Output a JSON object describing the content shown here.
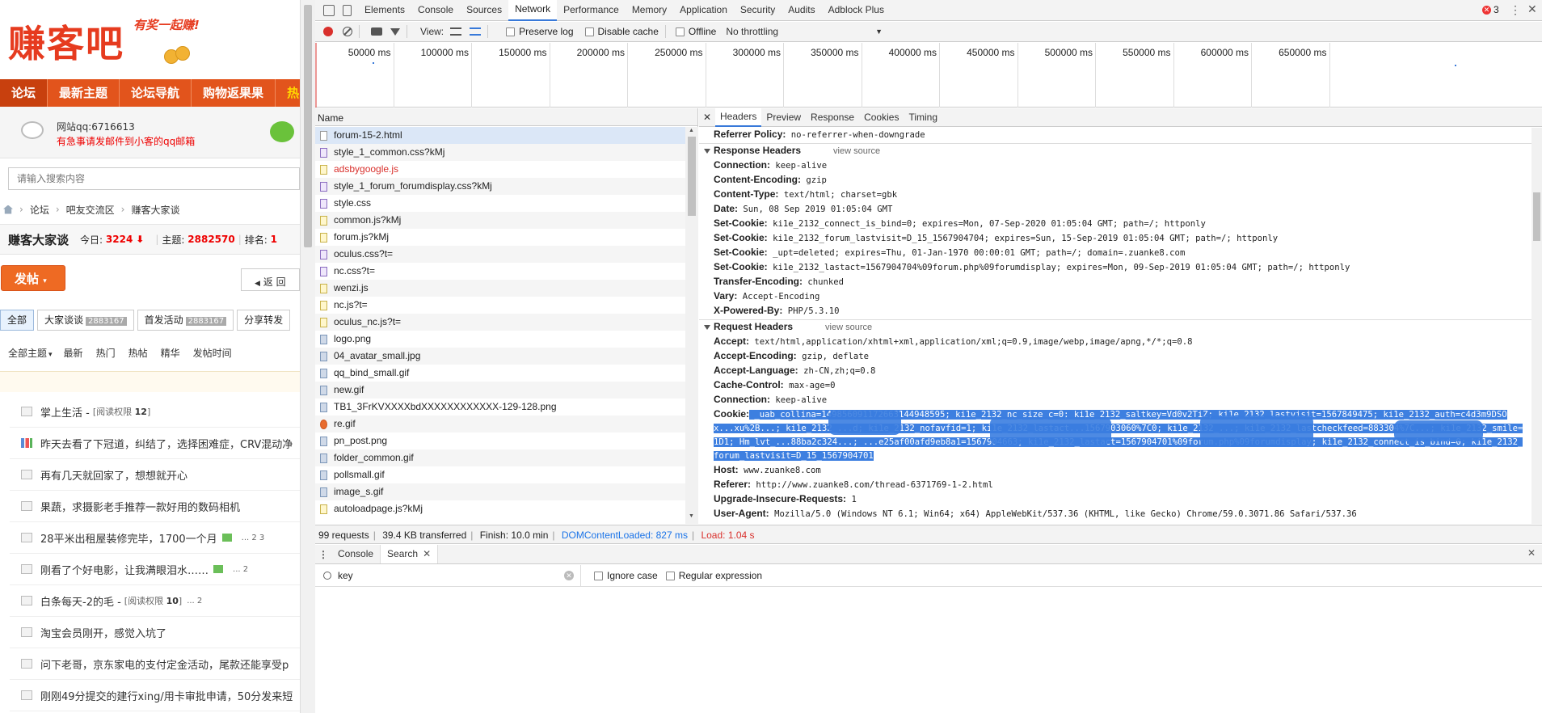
{
  "site": {
    "logo_text": "赚客吧",
    "slogan": "有奖一起赚!",
    "nav": [
      "论坛",
      "最新主题",
      "论坛导航",
      "购物返果果",
      "热"
    ],
    "notice_line1": "网站qq:6716613",
    "notice_line2": "有急事请发邮件到小客的qq邮箱",
    "search_placeholder": "请输入搜索内容",
    "breadcrumb": [
      "论坛",
      "吧友交流区",
      "赚客大家谈"
    ],
    "forum": {
      "name": "赚客大家谈",
      "today_label": "今日:",
      "today": "3224",
      "topics_label": "主题:",
      "topics": "2882570",
      "rank_label": "排名:",
      "rank": "1"
    },
    "post_button": "发帖",
    "back_button": "返 回",
    "tabs": [
      {
        "label": "全部",
        "count": ""
      },
      {
        "label": "大家谈谈",
        "count": "2883167"
      },
      {
        "label": "首发活动",
        "count": "2883167"
      },
      {
        "label": "分享转发",
        "count": ""
      }
    ],
    "sort": [
      "全部主题",
      "最新",
      "热门",
      "热帖",
      "精华",
      "发帖时间"
    ],
    "threads": [
      {
        "title": "掌上生活 - ",
        "meta": "[阅读权限 ",
        "level": "12",
        "close": "]",
        "pages": ""
      },
      {
        "title": "昨天去看了下冠道，纠结了，选择困难症，CRV混动净",
        "meta": "",
        "level": "",
        "close": "",
        "pages": ""
      },
      {
        "title": "再有几天就回家了，想想就开心",
        "meta": "",
        "level": "",
        "close": "",
        "pages": ""
      },
      {
        "title": "果蔬，求摄影老手推荐一款好用的数码相机",
        "meta": "",
        "level": "",
        "close": "",
        "pages": ""
      },
      {
        "title": "28平米出租屋装修完毕，1700一个月",
        "meta": "",
        "level": "",
        "close": "",
        "pages": "... 2  3"
      },
      {
        "title": "刚看了个好电影，让我满眼泪水……",
        "meta": "",
        "level": "",
        "close": "",
        "pages": "... 2"
      },
      {
        "title": "白条每天-2的毛 - ",
        "meta": "[阅读权限 ",
        "level": "10",
        "close": "]",
        "pages": "... 2"
      },
      {
        "title": "淘宝会员刚开，感觉入坑了",
        "meta": "",
        "level": "",
        "close": "",
        "pages": ""
      },
      {
        "title": "问下老哥，京东家电的支付定金活动，尾款还能享受p",
        "meta": "",
        "level": "",
        "close": "",
        "pages": ""
      },
      {
        "title": "刚刚49分提交的建行xing/用卡审批申请，50分发来短",
        "meta": "",
        "level": "",
        "close": "",
        "pages": ""
      }
    ]
  },
  "devtools": {
    "tabs": [
      "Elements",
      "Console",
      "Sources",
      "Network",
      "Performance",
      "Memory",
      "Application",
      "Security",
      "Audits",
      "Adblock Plus"
    ],
    "active_tab": "Network",
    "error_count": "3",
    "toolbar": {
      "view_label": "View:",
      "preserve_log": "Preserve log",
      "disable_cache": "Disable cache",
      "offline": "Offline",
      "throttling": "No throttling"
    },
    "timeline_ticks": [
      "50000 ms",
      "100000 ms",
      "150000 ms",
      "200000 ms",
      "250000 ms",
      "300000 ms",
      "350000 ms",
      "400000 ms",
      "450000 ms",
      "500000 ms",
      "550000 ms",
      "600000 ms",
      "650000 ms"
    ],
    "list_header": "Name",
    "requests": [
      {
        "name": "forum-15-2.html",
        "type": "doc",
        "error": false
      },
      {
        "name": "style_1_common.css?kMj",
        "type": "css",
        "error": false
      },
      {
        "name": "adsbygoogle.js",
        "type": "js",
        "error": true
      },
      {
        "name": "style_1_forum_forumdisplay.css?kMj",
        "type": "css",
        "error": false
      },
      {
        "name": "style.css",
        "type": "css",
        "error": false
      },
      {
        "name": "common.js?kMj",
        "type": "js",
        "error": false
      },
      {
        "name": "forum.js?kMj",
        "type": "js",
        "error": false
      },
      {
        "name": "oculus.css?t=",
        "type": "css",
        "error": false
      },
      {
        "name": "nc.css?t=",
        "type": "css",
        "error": false
      },
      {
        "name": "wenzi.js",
        "type": "js",
        "error": false
      },
      {
        "name": "nc.js?t=",
        "type": "js",
        "error": false
      },
      {
        "name": "oculus_nc.js?t=",
        "type": "js",
        "error": false
      },
      {
        "name": "logo.png",
        "type": "img",
        "error": false
      },
      {
        "name": "04_avatar_small.jpg",
        "type": "img",
        "error": false
      },
      {
        "name": "qq_bind_small.gif",
        "type": "img",
        "error": false
      },
      {
        "name": "new.gif",
        "type": "img",
        "error": false
      },
      {
        "name": "TB1_3FrKVXXXXbdXXXXXXXXXXXX-129-128.png",
        "type": "img",
        "error": false
      },
      {
        "name": "re.gif",
        "type": "red",
        "error": false
      },
      {
        "name": "pn_post.png",
        "type": "img",
        "error": false
      },
      {
        "name": "folder_common.gif",
        "type": "img",
        "error": false
      },
      {
        "name": "pollsmall.gif",
        "type": "img",
        "error": false
      },
      {
        "name": "image_s.gif",
        "type": "img",
        "error": false
      },
      {
        "name": "autoloadpage.js?kMj",
        "type": "js",
        "error": false
      }
    ],
    "status": {
      "requests": "99 requests",
      "transferred": "39.4 KB transferred",
      "finish": "Finish: 10.0 min",
      "dcl": "DOMContentLoaded: 827 ms",
      "load": "Load: 1.04 s"
    },
    "detail_tabs": [
      "Headers",
      "Preview",
      "Response",
      "Cookies",
      "Timing"
    ],
    "referrer_policy": {
      "k": "Referrer Policy:",
      "v": "no-referrer-when-downgrade"
    },
    "response_headers_title": "Response Headers",
    "request_headers_title": "Request Headers",
    "view_source": "view source",
    "response_headers": [
      {
        "k": "Connection:",
        "v": "keep-alive"
      },
      {
        "k": "Content-Encoding:",
        "v": "gzip"
      },
      {
        "k": "Content-Type:",
        "v": "text/html; charset=gbk"
      },
      {
        "k": "Date:",
        "v": "Sun, 08 Sep 2019 01:05:04 GMT"
      },
      {
        "k": "Set-Cookie:",
        "v": "ki1e_2132_connect_is_bind=0; expires=Mon, 07-Sep-2020 01:05:04 GMT; path=/; httponly"
      },
      {
        "k": "Set-Cookie:",
        "v": "ki1e_2132_forum_lastvisit=D_15_1567904704; expires=Sun, 15-Sep-2019 01:05:04 GMT; path=/; httponly"
      },
      {
        "k": "Set-Cookie:",
        "v": "_upt=deleted; expires=Thu, 01-Jan-1970 00:00:01 GMT; path=/; domain=.zuanke8.com"
      },
      {
        "k": "Set-Cookie:",
        "v": "ki1e_2132_lastact=1567904704%09forum.php%09forumdisplay; expires=Mon, 09-Sep-2019 01:05:04 GMT; path=/; httponly"
      },
      {
        "k": "Transfer-Encoding:",
        "v": "chunked"
      },
      {
        "k": "Vary:",
        "v": "Accept-Encoding"
      },
      {
        "k": "X-Powered-By:",
        "v": "PHP/5.3.10"
      }
    ],
    "request_headers": [
      {
        "k": "Accept:",
        "v": "text/html,application/xhtml+xml,application/xml;q=0.9,image/webp,image/apng,*/*;q=0.8"
      },
      {
        "k": "Accept-Encoding:",
        "v": "gzip, deflate"
      },
      {
        "k": "Accept-Language:",
        "v": "zh-CN,zh;q=0.8"
      },
      {
        "k": "Cache-Control:",
        "v": "max-age=0"
      },
      {
        "k": "Connection:",
        "v": "keep-alive"
      }
    ],
    "cookie_key": "Cookie:",
    "cookie_value": " _uab_collina=149856091172663144948595; ki1e_2132_nc_size_c=0; ki1e_2132_saltkey=Vd0v2TiZ; ki1e_2132_lastvisit=1567849475; ki1e_2132_auth=c4d3m9DSOx...xu%2B...; ki1e_2132_...d; ki1e_2132_nofavfid=1; ki1e_2132_lastact...1567903060%7C0; ki1e_2132_...; ki1e_2132_lastcheckfeed=883304%7C...; ki1e_2132_smile=1D1; Hm_lvt_...88ba2c324...; ...e25af00afd9eb8a1=1567904663; ki1e_2132_lastact=1567904701%09forum.php%09forumdisplay; ki1e_2132_connect_is_bind=0; ki1e_2132_forum_lastvisit=D_15_1567904701",
    "request_headers_after": [
      {
        "k": "Host:",
        "v": "www.zuanke8.com"
      },
      {
        "k": "Referer:",
        "v": "http://www.zuanke8.com/thread-6371769-1-2.html"
      },
      {
        "k": "Upgrade-Insecure-Requests:",
        "v": "1"
      },
      {
        "k": "User-Agent:",
        "v": "Mozilla/5.0 (Windows NT 6.1; Win64; x64) AppleWebKit/537.36 (KHTML, like Gecko) Chrome/59.0.3071.86 Safari/537.36"
      }
    ],
    "drawer_tabs": [
      "Console",
      "Search"
    ],
    "search": {
      "query": "key",
      "ignore_case": "Ignore case",
      "regex": "Regular expression"
    }
  }
}
